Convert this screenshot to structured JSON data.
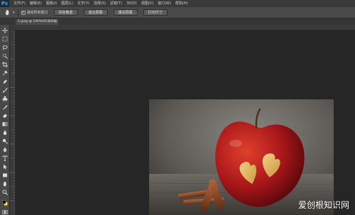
{
  "app": {
    "logo": "Ps"
  },
  "menu": {
    "items": [
      "文件(F)",
      "编辑(E)",
      "图像(I)",
      "图层(L)",
      "文字(Y)",
      "选择(S)",
      "滤镜(T)",
      "3D(D)",
      "视图(V)",
      "窗口(W)",
      "帮助(H)"
    ]
  },
  "options": {
    "tool_icon": "hand-tool-icon",
    "check_mark": "✓",
    "checkbox_label": "滚动所有窗口",
    "buttons": [
      "实际像素",
      "适合屏幕",
      "填充屏幕",
      "打印尺寸"
    ]
  },
  "document": {
    "tab_label": "1.jpeg @ 100%(RGB/8#)",
    "close_glyph": "×"
  },
  "watermark": {
    "text": "爱创根知识网"
  },
  "colors": {
    "foreground": "#000000",
    "background": "#ffe100"
  }
}
